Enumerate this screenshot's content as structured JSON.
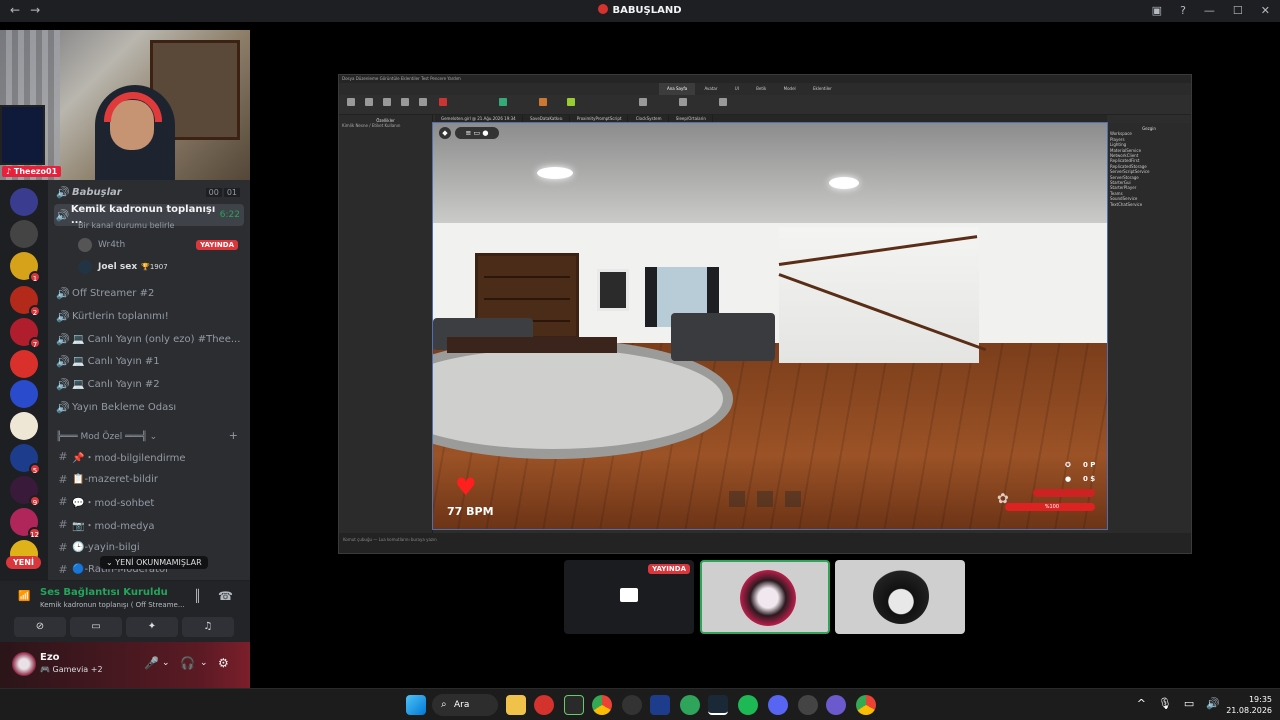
{
  "window": {
    "title": "BABUŞLAND",
    "back": "←",
    "forward": "→"
  },
  "webcam": {
    "tag": "Theezo01"
  },
  "servers": {
    "badges": [
      "1",
      "2",
      "7",
      "5",
      "9",
      "12"
    ],
    "new_label": "YENİ",
    "colors": [
      "#3a3d8f",
      "#2f2f2f",
      "#d6a21a",
      "#b32a1a",
      "#b01e2e",
      "#d9302b",
      "#2a4bcc",
      "#efe7d6",
      "#1d3c8c",
      "#3a1a3a",
      "#b0265b",
      "#e0b21a"
    ]
  },
  "channels": {
    "category_top": {
      "name": "Babuşlar",
      "count_a": "00",
      "count_b": "01"
    },
    "active_voice": {
      "name": "Kemik kadronun toplanışı ...",
      "timer": "6:22",
      "status": "Bir kanal durumu belirle"
    },
    "voice_users": [
      {
        "name": "Wr4th",
        "badge": "YAYINDA"
      },
      {
        "name": "Joel sex",
        "score": "🏆1907"
      }
    ],
    "voice_channels": [
      "Off Streamer #2",
      "Kürtlerin toplanımı!",
      "💻 Canlı Yayın (only ezo) #Thee...",
      "💻 Canlı Yayın #1",
      "💻 Canlı Yayın #2",
      "Yayın Bekleme Odası"
    ],
    "category_mod": "╠═══ Mod Özel ═══╣",
    "text_channels": [
      "📌・mod-bilgilendirme",
      "📋-mazeret-bildir",
      "💬・mod-sohbet",
      "📷・mod-medya",
      "🕒-yayin-bilgi",
      "🔵-Ratin-Moderator"
    ],
    "unread_tip": "YENİ OKUNMAMIŞLAR"
  },
  "voice_panel": {
    "status": "Ses Bağlantısı Kuruldu",
    "channel": "Kemik kadronun toplanışı ( Off Streame..."
  },
  "user": {
    "name": "Ezo",
    "activity": "Gamevia +2"
  },
  "studio": {
    "menu": "Dosya  Düzenleme  Görüntüle  Eklentiler  Test  Pencere  Yardım",
    "tabs": [
      "Ana Sayfa",
      "Avatar",
      "UI",
      "Betik",
      "Model",
      "Eklentiler"
    ],
    "doc_tabs": [
      "Gemeloten.girl @ 21.Ağu.2026 19:34",
      "SaveDataKatkısı",
      "ProximityPromptScript",
      "ClockSystem",
      "Sleep/Ortalarin"
    ],
    "explorer_title": "Gezgin",
    "explorer": [
      "Workspace",
      "Players",
      "Lighting",
      "MaterialService",
      "NetworkClient",
      "ReplicatedFirst",
      "ReplicatedStorage",
      "ServerScriptService",
      "ServerStorage",
      "StarterGui",
      "StarterPlayer",
      "Teams",
      "SoundService",
      "TextChatService"
    ],
    "left_title": "Özellikler",
    "left_hint": "Kimlik Nesne / Etiket Kullanın",
    "bottom": "Komut çubuğu — Lua komutlarını buraya yazın"
  },
  "hud": {
    "bpm": "77 BPM",
    "points": "0 P",
    "money": "0 $",
    "health": "%100"
  },
  "streams": {
    "live_label": "YAYINDA"
  },
  "taskbar": {
    "search": "Ara",
    "time": "19:35",
    "date": "21.08.2026"
  }
}
